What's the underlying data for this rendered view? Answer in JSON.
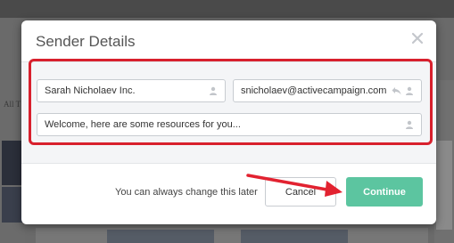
{
  "background": {
    "left_fragment": "All T"
  },
  "modal": {
    "title": "Sender Details",
    "close_icon": "close-icon",
    "fields": {
      "name": {
        "value": "Sarah Nicholaev Inc.",
        "icon": "user-icon"
      },
      "email": {
        "value": "snicholaev@activecampaign.com",
        "icons": [
          "reply-icon",
          "user-icon"
        ]
      },
      "message": {
        "value": "Welcome, here are some resources for you...",
        "icon": "user-icon"
      }
    },
    "footer": {
      "note": "You can always change this later",
      "cancel_label": "Cancel",
      "continue_label": "Continue"
    }
  },
  "colors": {
    "annotation": "#d8202d",
    "continue_button": "#5cc5a0",
    "overlay": "#5b5b5b"
  }
}
